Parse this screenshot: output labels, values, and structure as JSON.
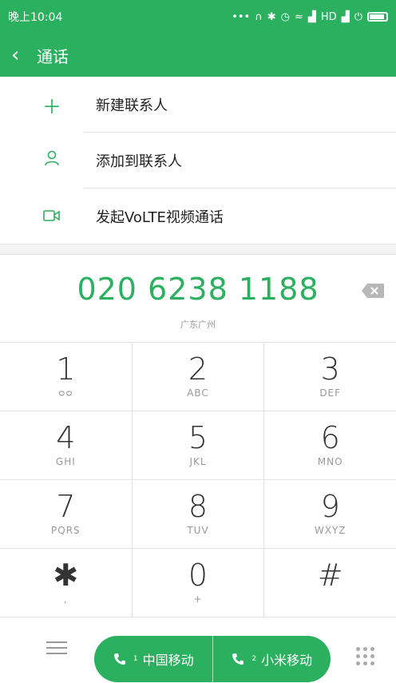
{
  "status_bar": {
    "time": "晚上10:04",
    "network": "HD"
  },
  "header": {
    "title": "通话"
  },
  "actions": [
    {
      "icon": "plus-icon",
      "label": "新建联系人"
    },
    {
      "icon": "person-icon",
      "label": "添加到联系人"
    },
    {
      "icon": "video-icon",
      "label": "发起VoLTE视频通话"
    }
  ],
  "display": {
    "number": "020 6238 1188",
    "location": "广东广州"
  },
  "keypad": [
    {
      "digit": "1",
      "letters": "ᴑᴑ"
    },
    {
      "digit": "2",
      "letters": "ABC"
    },
    {
      "digit": "3",
      "letters": "DEF"
    },
    {
      "digit": "4",
      "letters": "GHI"
    },
    {
      "digit": "5",
      "letters": "JKL"
    },
    {
      "digit": "6",
      "letters": "MNO"
    },
    {
      "digit": "7",
      "letters": "PQRS"
    },
    {
      "digit": "8",
      "letters": "TUV"
    },
    {
      "digit": "9",
      "letters": "WXYZ"
    },
    {
      "digit": "✱",
      "letters": ","
    },
    {
      "digit": "0",
      "letters": "+"
    },
    {
      "digit": "#",
      "letters": ""
    }
  ],
  "bottom": {
    "sim1": {
      "label": "中国移动",
      "slot": "1"
    },
    "sim2": {
      "label": "小米移动",
      "slot": "2"
    }
  },
  "colors": {
    "accent": "#2bb05f"
  }
}
